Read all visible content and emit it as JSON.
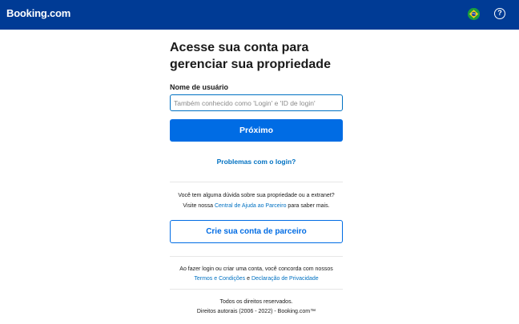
{
  "header": {
    "logo": "Booking.com",
    "flag_icon": "brazil-flag-icon",
    "help_icon": "question-circle-icon",
    "help_glyph": "?"
  },
  "login": {
    "title": "Acesse sua conta para gerenciar sua propriedade",
    "username_label": "Nome de usuário",
    "username_value": "",
    "username_placeholder": "Também conhecido como 'Login' e 'ID de login'",
    "next_button": "Próximo",
    "trouble_link": "Problemas com o login?"
  },
  "help": {
    "line1": "Você tem alguma dúvida sobre sua propriedade ou a extranet?",
    "line2_prefix": "Visite nossa ",
    "link": "Central de Ajuda ao Parceiro",
    "line2_suffix": " para saber mais."
  },
  "partner": {
    "create_button": "Crie sua conta de parceiro"
  },
  "terms": {
    "line1": "Ao fazer login ou criar uma conta, você concorda com nossos",
    "terms_link": "Termos e Condições",
    "conjunction": " e ",
    "privacy_link": "Declaração de Privacidade"
  },
  "footer": {
    "rights": "Todos os direitos reservados.",
    "copyright": "Direitos autorais (2006 - 2022) - Booking.com™"
  },
  "colors": {
    "header_bg": "#003b95",
    "primary": "#006ce4",
    "link": "#0071c2"
  }
}
